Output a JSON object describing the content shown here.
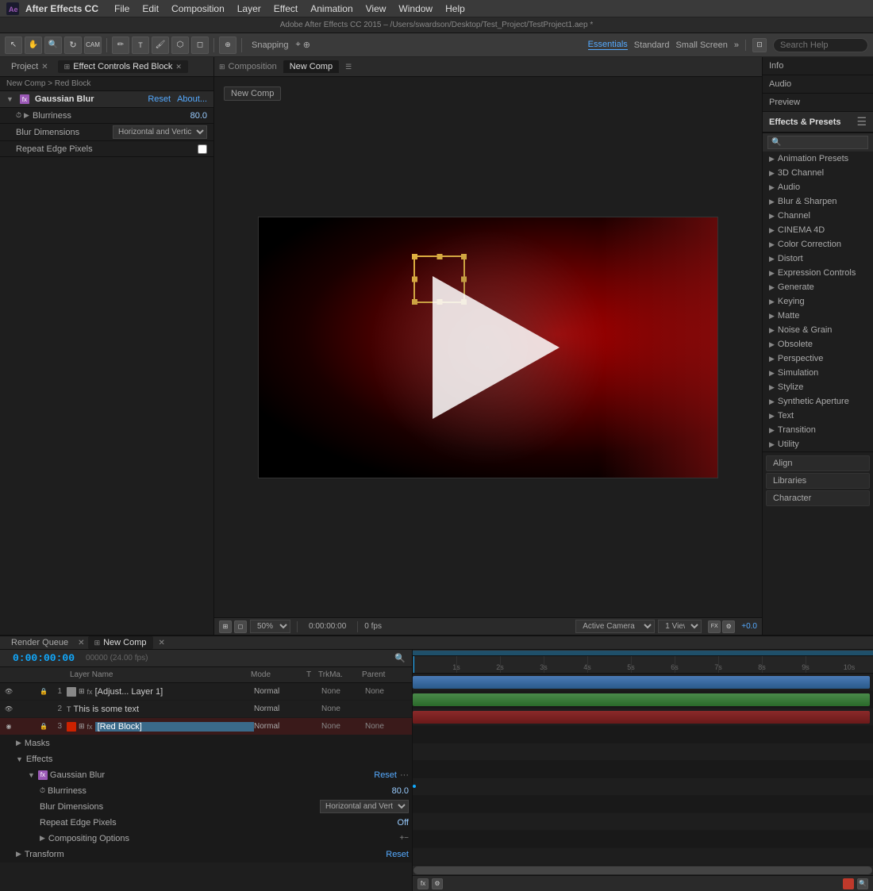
{
  "app": {
    "name": "After Effects CC",
    "title": "Adobe After Effects CC 2015 – /Users/swardson/Desktop/Test_Project/TestProject1.aep *"
  },
  "menubar": {
    "items": [
      "File",
      "Edit",
      "Composition",
      "Layer",
      "Effect",
      "Animation",
      "View",
      "Window",
      "Help"
    ]
  },
  "toolbar": {
    "snapping_label": "Snapping",
    "workspaces": [
      "Essentials",
      "Standard",
      "Small Screen"
    ],
    "active_workspace": "Essentials",
    "search_placeholder": "Search Help"
  },
  "left_panel": {
    "tabs": [
      {
        "label": "Project",
        "active": false
      },
      {
        "label": "Effect Controls Red Block",
        "active": true
      }
    ],
    "breadcrumb": "New Comp > Red Block",
    "effect": {
      "name": "Gaussian Blur",
      "reset_label": "Reset",
      "about_label": "About...",
      "properties": [
        {
          "name": "Blurriness",
          "value": "80.0"
        },
        {
          "name": "Blur Dimensions",
          "value": "Horizontal and Vertic"
        },
        {
          "name": "Repeat Edge Pixels",
          "value": ""
        }
      ]
    }
  },
  "composition": {
    "tab_label": "New Comp",
    "new_comp_btn": "New Comp",
    "zoom": "50%",
    "timecode": "0:00:00:00",
    "extra": "0 fps",
    "view": "Active Camera",
    "views_label": "1 View"
  },
  "right_panel": {
    "sections": [
      "Info",
      "Audio",
      "Preview"
    ],
    "effects_presets": {
      "title": "Effects & Presets",
      "items": [
        "Animation Presets",
        "3D Channel",
        "Audio",
        "Blur & Sharpen",
        "Channel",
        "CINEMA 4D",
        "Color Correction",
        "Distort",
        "Expression Controls",
        "Generate",
        "Keying",
        "Matte",
        "Noise & Grain",
        "Obsolete",
        "Perspective",
        "Simulation",
        "Stylize",
        "Synthetic Aperture",
        "Text",
        "Transition",
        "Utility"
      ]
    },
    "bottom_sections": [
      "Align",
      "Libraries",
      "Character"
    ]
  },
  "timeline": {
    "tabs": [
      {
        "label": "Render Queue"
      },
      {
        "label": "New Comp",
        "active": true
      }
    ],
    "timecode": "0:00:00:00",
    "fps": "00000 (24.00 fps)",
    "column_headers": {
      "layer_name": "Layer Name",
      "mode": "Mode",
      "t": "T",
      "trkmatte": "TrkMa.",
      "parent": "Parent"
    },
    "layers": [
      {
        "num": "1",
        "icon": "gray",
        "name": "[Adjust... Layer 1]",
        "mode": "Normal",
        "t": "",
        "trkmatte": "None",
        "parent": "None"
      },
      {
        "num": "2",
        "icon": "text",
        "name": "This is some text",
        "mode": "Normal",
        "t": "",
        "trkmatte": "None",
        "parent": ""
      },
      {
        "num": "3",
        "icon": "red",
        "name": "[Red Block]",
        "mode": "Normal",
        "t": "",
        "trkmatte": "None",
        "parent": "None",
        "selected": true
      }
    ],
    "properties": {
      "masks_label": "Masks",
      "effects_label": "Effects",
      "gaussian_blur": {
        "label": "Gaussian Blur",
        "reset_label": "Reset",
        "blurriness_label": "Blurriness",
        "blurriness_value": "80.0",
        "blur_dimensions_label": "Blur Dimensions",
        "blur_dimensions_value": "Horizontal and Vert",
        "repeat_edge_label": "Repeat Edge Pixels",
        "repeat_edge_value": "Off",
        "compositing_label": "Compositing Options"
      },
      "transform_label": "Transform",
      "transform_reset": "Reset"
    },
    "ruler_marks": [
      "1s",
      "2s",
      "3s",
      "4s",
      "5s",
      "6s",
      "7s",
      "8s",
      "9s",
      "10s"
    ]
  }
}
